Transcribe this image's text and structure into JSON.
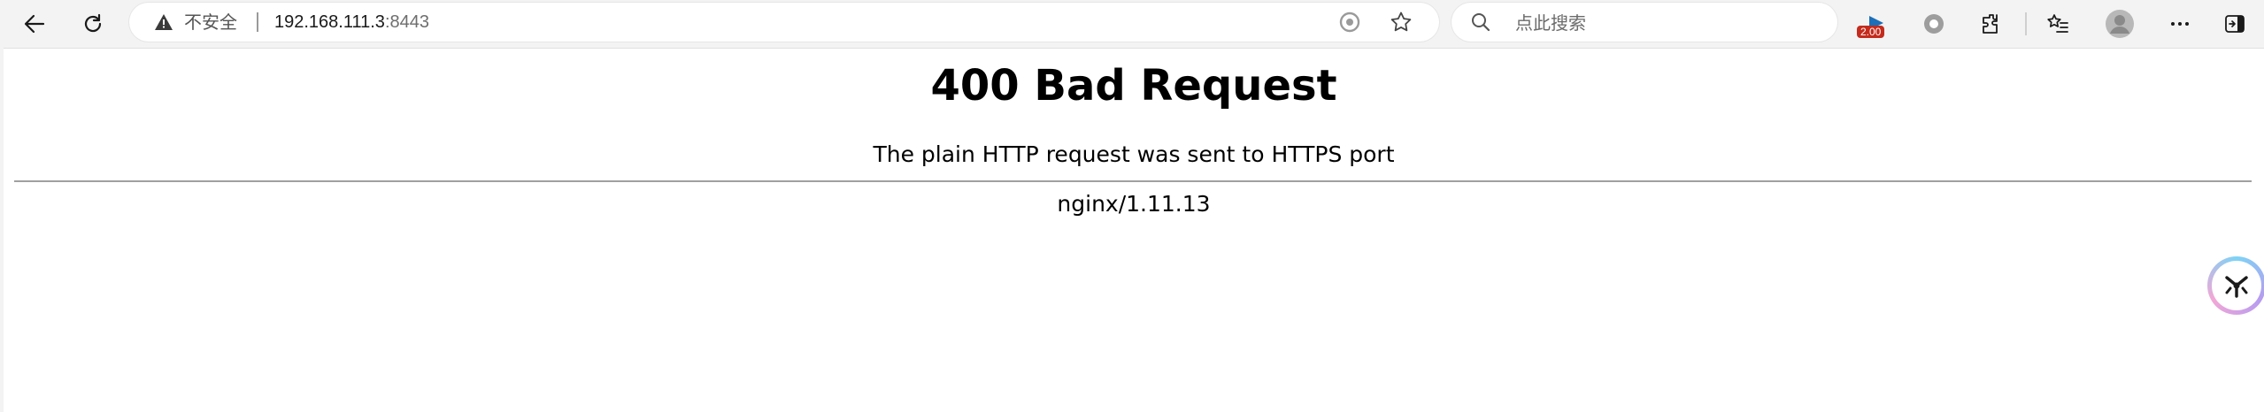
{
  "browser": {
    "address_bar": {
      "security_label": "不安全",
      "url_host": "192.168.111.3",
      "url_port": ":8443"
    },
    "search": {
      "placeholder": "点此搜索"
    },
    "extension_badge": "2.00",
    "icons": {
      "back": "back-arrow-icon",
      "refresh": "refresh-icon",
      "warning": "warning-triangle-icon",
      "read_aloud": "read-aloud-icon",
      "favorite": "star-icon",
      "search": "search-icon",
      "extension": "extension-icon",
      "tracking": "circle-record-icon",
      "extensions": "puzzle-icon",
      "favorites": "favorites-list-icon",
      "profile": "profile-avatar-icon",
      "more": "more-dots-icon",
      "sidebar": "sidebar-toggle-icon",
      "assistant": "assistant-bubble-icon"
    },
    "colors": {
      "toolbar_bg": "#f3f3f3",
      "badge_bg": "#c42b1c",
      "extension_icon": "#1c6fb8"
    }
  },
  "page": {
    "title": "400 Bad Request",
    "message": "The plain HTTP request was sent to HTTPS port",
    "server": "nginx/1.11.13"
  }
}
